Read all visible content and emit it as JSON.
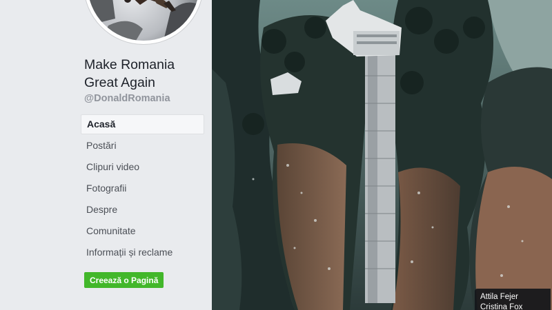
{
  "page": {
    "name": "Make Romania Great Again",
    "handle": "@DonaldRomania"
  },
  "nav": {
    "items": [
      {
        "label": "Acasă",
        "active": true
      },
      {
        "label": "Postări"
      },
      {
        "label": "Clipuri video"
      },
      {
        "label": "Fotografii"
      },
      {
        "label": "Despre"
      },
      {
        "label": "Comunitate"
      },
      {
        "label": "Informații și reclame"
      }
    ]
  },
  "create_page_button": "Creează o Pagină",
  "tooltip": {
    "lines": [
      "Attila Fejer",
      "Cristina Fox"
    ]
  },
  "colors": {
    "background": "#e9ebee",
    "create_button": "#42b72a",
    "text_primary": "#1d2129",
    "text_muted": "#90949c"
  },
  "icons": {
    "profile_picture": "profile-photo",
    "cover_photo": "elevator-cliff-photo"
  }
}
